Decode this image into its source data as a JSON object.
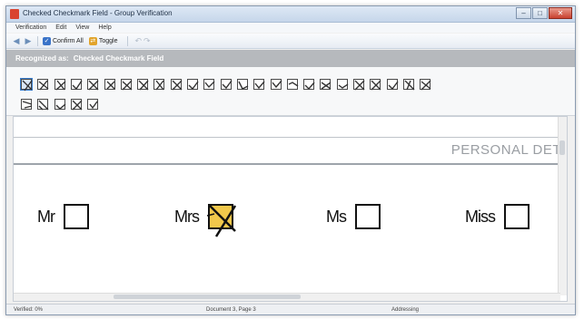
{
  "window": {
    "title": "Checked Checkmark Field - Group Verification",
    "controls": {
      "minimize": "–",
      "maximize": "□",
      "close": "✕"
    }
  },
  "menu": [
    "Verification",
    "Edit",
    "View",
    "Help"
  ],
  "toolbar": {
    "back_icon": "arrow-left-icon",
    "forward_icon": "arrow-right-icon",
    "confirm_all_label": "Confirm All",
    "toggle_label": "Toggle",
    "undo_icon": "undo-icon"
  },
  "recognition": {
    "label": "Recognized as:",
    "value": "Checked Checkmark Field"
  },
  "document": {
    "heading": "PERSONAL DET",
    "fields": [
      {
        "label": "Mr",
        "checked": false
      },
      {
        "label": "Mrs",
        "checked": true
      },
      {
        "label": "Ms",
        "checked": false
      },
      {
        "label": "Miss",
        "checked": false
      }
    ],
    "checked_highlight": "#f1c84b"
  },
  "status": {
    "left": "Verified: 0%",
    "middle": "Document 3, Page 3",
    "right": "Addressing"
  },
  "colors": {
    "recog_bar": "#b6b9bd",
    "title_bar": "#c6d6ea",
    "close_button": "#c9412f"
  }
}
